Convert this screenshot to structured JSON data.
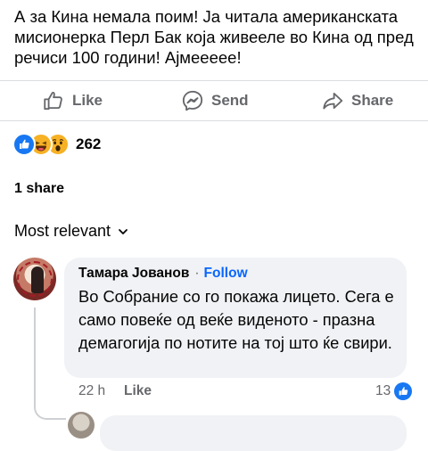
{
  "post": {
    "text": "А за Кина немала поим! Ја читала американската мисионерка Перл Бак која живееле во Кина од пред речиси 100 години! Ајмеееее!"
  },
  "actions": {
    "like_label": "Like",
    "send_label": "Send",
    "share_label": "Share"
  },
  "reactions": {
    "icons": [
      "like-reaction-icon",
      "haha-reaction-icon",
      "wow-reaction-icon"
    ],
    "count": "262"
  },
  "shares": {
    "label": "1 share"
  },
  "comments_sort": {
    "label": "Most relevant"
  },
  "comment": {
    "author": "Тамара Јованов",
    "separator": "·",
    "follow_label": "Follow",
    "text": "Во Собрание со го покажа лицето. Сега е само повеќе од веќе виденото - празна демагогија по нотите на тој што ќе свири.",
    "time": "22 h",
    "like_label": "Like",
    "like_count": "13"
  },
  "colors": {
    "accent": "#0866ff",
    "like_blue": "#1877f2",
    "muted": "#65676b",
    "bubble_bg": "#f0f2f5",
    "text": "#050505"
  }
}
